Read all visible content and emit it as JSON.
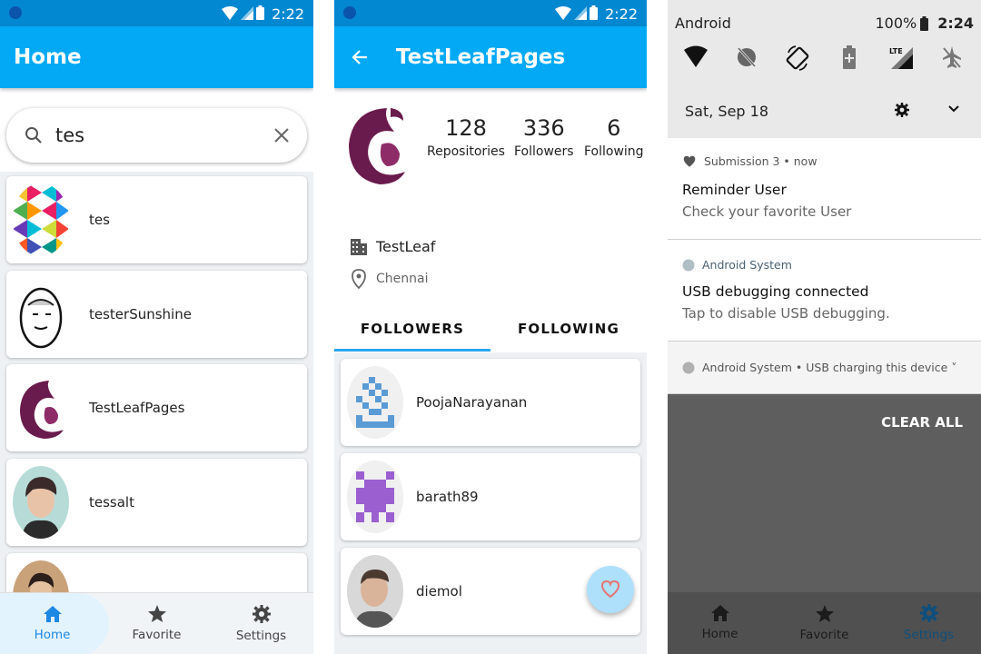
{
  "status": {
    "time_left": "2:22",
    "time_middle": "2:22"
  },
  "search_screen": {
    "title": "Home",
    "query": "tes",
    "results": [
      {
        "name": "tes"
      },
      {
        "name": "testerSunshine"
      },
      {
        "name": "TestLeafPages"
      },
      {
        "name": "tessalt"
      },
      {
        "name": ""
      }
    ],
    "nav": {
      "home": "Home",
      "favorite": "Favorite",
      "settings": "Settings"
    }
  },
  "profile_screen": {
    "title": "TestLeafPages",
    "repositories": "128",
    "repositories_label": "Repositories",
    "followers": "336",
    "followers_label": "Followers",
    "following": "6",
    "following_label": "Following",
    "company": "TestLeaf",
    "location": "Chennai",
    "tab_followers": "FOLLOWERS",
    "tab_following": "FOLLOWING",
    "list": [
      {
        "name": "PoojaNarayanan"
      },
      {
        "name": "barath89"
      },
      {
        "name": "diemol"
      }
    ]
  },
  "notification_shade": {
    "carrier": "Android",
    "battery": "100%",
    "time": "2:24",
    "date": "Sat, Sep 18",
    "notifications": [
      {
        "app": "Submission 3 • now",
        "title": "Reminder User",
        "text": "Check your favorite User"
      },
      {
        "app": "Android System",
        "title": "USB debugging connected",
        "text": "Tap to disable USB debugging."
      },
      {
        "app": "Android System • USB charging this device ˅"
      }
    ],
    "clear_all": "CLEAR ALL",
    "nav": {
      "home": "Home",
      "favorite": "Favorite",
      "settings": "Settings"
    }
  },
  "colors": {
    "primary": "#03a9f4",
    "status": "#0288d1",
    "accent": "#1e88e5"
  }
}
